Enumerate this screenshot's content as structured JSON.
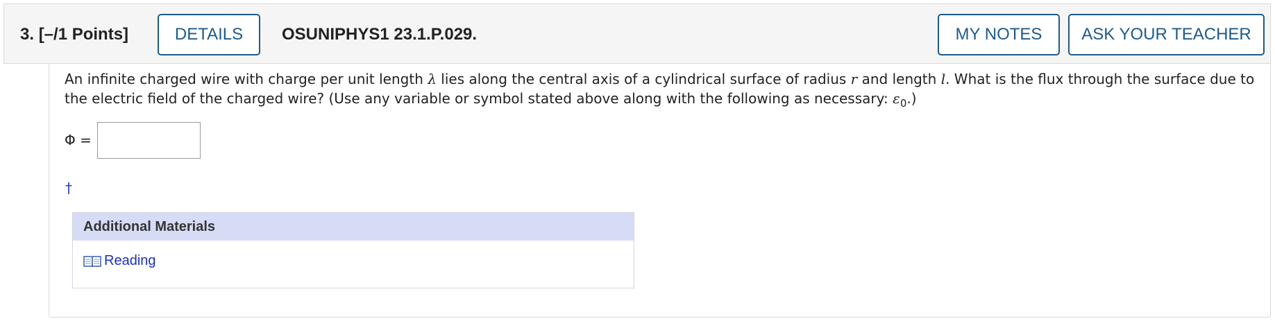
{
  "header": {
    "question_number": "3.",
    "points": "[–/1 Points]",
    "details_label": "DETAILS",
    "question_code": "OSUNIPHYS1 23.1.P.029.",
    "my_notes_label": "MY NOTES",
    "ask_teacher_label": "ASK YOUR TEACHER"
  },
  "question": {
    "text_part1": "An infinite charged wire with charge per unit length ",
    "lambda": "λ",
    "text_part2": " lies along the central axis of a cylindrical surface of radius ",
    "r": "r",
    "text_part3": " and length ",
    "l": "l",
    "text_part4": ". What is the flux through the surface due to the electric field of the charged wire? (Use any variable or symbol stated above along with the following as necessary: ",
    "epsilon": "ε",
    "epsilon_sub": "0",
    "text_part5": ".)"
  },
  "answer": {
    "label": "Φ =",
    "value": "",
    "placeholder": ""
  },
  "dagger": "†",
  "materials": {
    "heading": "Additional Materials",
    "link_label": "Reading",
    "link_icon": "book-icon"
  },
  "colors": {
    "button_border": "#1d5a8a",
    "link": "#1a2fbd",
    "materials_header_bg": "#d6dcf5"
  }
}
